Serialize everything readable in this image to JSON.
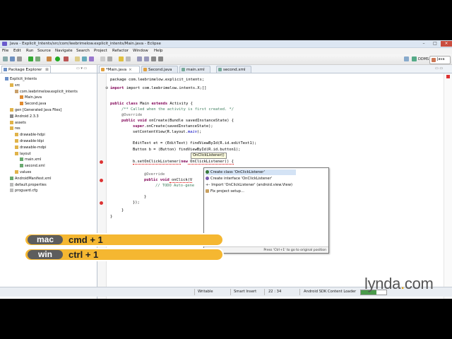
{
  "window": {
    "title": "Java - Explicit_Intents/src/com/leebrimelow.explicit_intents/Main.java - Eclipse"
  },
  "menu": [
    "File",
    "Edit",
    "Run",
    "Source",
    "Navigate",
    "Search",
    "Project",
    "Refactor",
    "Window",
    "Help"
  ],
  "perspectives": {
    "ddms": "DDMS",
    "java": "Java"
  },
  "package_explorer": {
    "tab_label": "Package Explorer",
    "items": [
      {
        "label": "Explicit_Intents",
        "indent": 1,
        "icon": "project-icon"
      },
      {
        "label": "src",
        "indent": 2,
        "icon": "folder-icon"
      },
      {
        "label": "com.leebrimelow.explicit_intents",
        "indent": 3,
        "icon": "package-icon"
      },
      {
        "label": "Main.java",
        "indent": 4,
        "icon": "java-file-icon"
      },
      {
        "label": "Second.java",
        "indent": 4,
        "icon": "java-file-icon"
      },
      {
        "label": "gen [Generated Java Files]",
        "indent": 2,
        "icon": "folder-icon"
      },
      {
        "label": "Android 2.3.3",
        "indent": 2,
        "icon": "library-icon"
      },
      {
        "label": "assets",
        "indent": 2,
        "icon": "folder-icon"
      },
      {
        "label": "res",
        "indent": 2,
        "icon": "folder-icon"
      },
      {
        "label": "drawable-hdpi",
        "indent": 3,
        "icon": "folder-icon"
      },
      {
        "label": "drawable-ldpi",
        "indent": 3,
        "icon": "folder-icon"
      },
      {
        "label": "drawable-mdpi",
        "indent": 3,
        "icon": "folder-icon"
      },
      {
        "label": "layout",
        "indent": 3,
        "icon": "folder-icon"
      },
      {
        "label": "main.xml",
        "indent": 4,
        "icon": "xml-file-icon"
      },
      {
        "label": "second.xml",
        "indent": 4,
        "icon": "xml-file-icon"
      },
      {
        "label": "values",
        "indent": 3,
        "icon": "folder-icon"
      },
      {
        "label": "AndroidManifest.xml",
        "indent": 2,
        "icon": "xml-file-icon"
      },
      {
        "label": "default.properties",
        "indent": 2,
        "icon": "file-icon"
      },
      {
        "label": "proguard.cfg",
        "indent": 2,
        "icon": "file-icon"
      }
    ]
  },
  "editor_tabs": [
    {
      "label": "*Main.java",
      "active": true
    },
    {
      "label": "Second.java",
      "active": false
    },
    {
      "label": "main.xml",
      "active": false
    },
    {
      "label": "second.xml",
      "active": false
    }
  ],
  "code": {
    "l1": "package com.leebrimelow.explicit_intents;",
    "l2": "import com.leebrimelow.intents.X;[]",
    "l3a": "public class",
    "l3b": " Main ",
    "l3c": "extends",
    "l3d": " Activity {",
    "l4": "/** Called when the activity is first created. */",
    "l5": "@Override",
    "l6a": "public void",
    "l6b": " onCreate(Bundle savedInstanceState) {",
    "l7a": "super",
    "l7b": ".onCreate(savedInstanceState);",
    "l8a": "setContentView(R.layout.",
    "l8b": "main",
    "l8c": ");",
    "l9": "EditText et = (EditText) findViewById(R.id.editText1);",
    "l10": "Button b = (Button) findViewById(R.id.button1);",
    "l11a": "b.setOnClickListener(",
    "l11b": "new",
    "l11c": " OnClickListener() {",
    "l12": "@Override",
    "l13a": "public void",
    "l13b": " onClick(V",
    "l14": "// TODO Auto-gene",
    "l15": "}",
    "l16": "});",
    "l17": "}",
    "l18": "}"
  },
  "tooltip": "OnClickListener()",
  "quickfix": {
    "items": [
      "Create class 'OnClickListener'",
      "Create interface 'OnClickListener'",
      "Import 'OnClickListener' (android.view.View)",
      "Fix project setup..."
    ],
    "footer": "Press 'Ctrl+1' to go to original position"
  },
  "status": {
    "writable": "Writable",
    "insert": "Smart Insert",
    "position": "22 : 34",
    "loader": "Android SDK Content Loader"
  },
  "shortcuts": [
    {
      "os": "mac",
      "keys": "cmd + 1"
    },
    {
      "os": "win",
      "keys": "ctrl + 1"
    }
  ],
  "watermark": "lynda.com",
  "colors": {
    "accent": "#f5b731",
    "keyword": "#7f0055",
    "comment": "#3f7f5f"
  }
}
